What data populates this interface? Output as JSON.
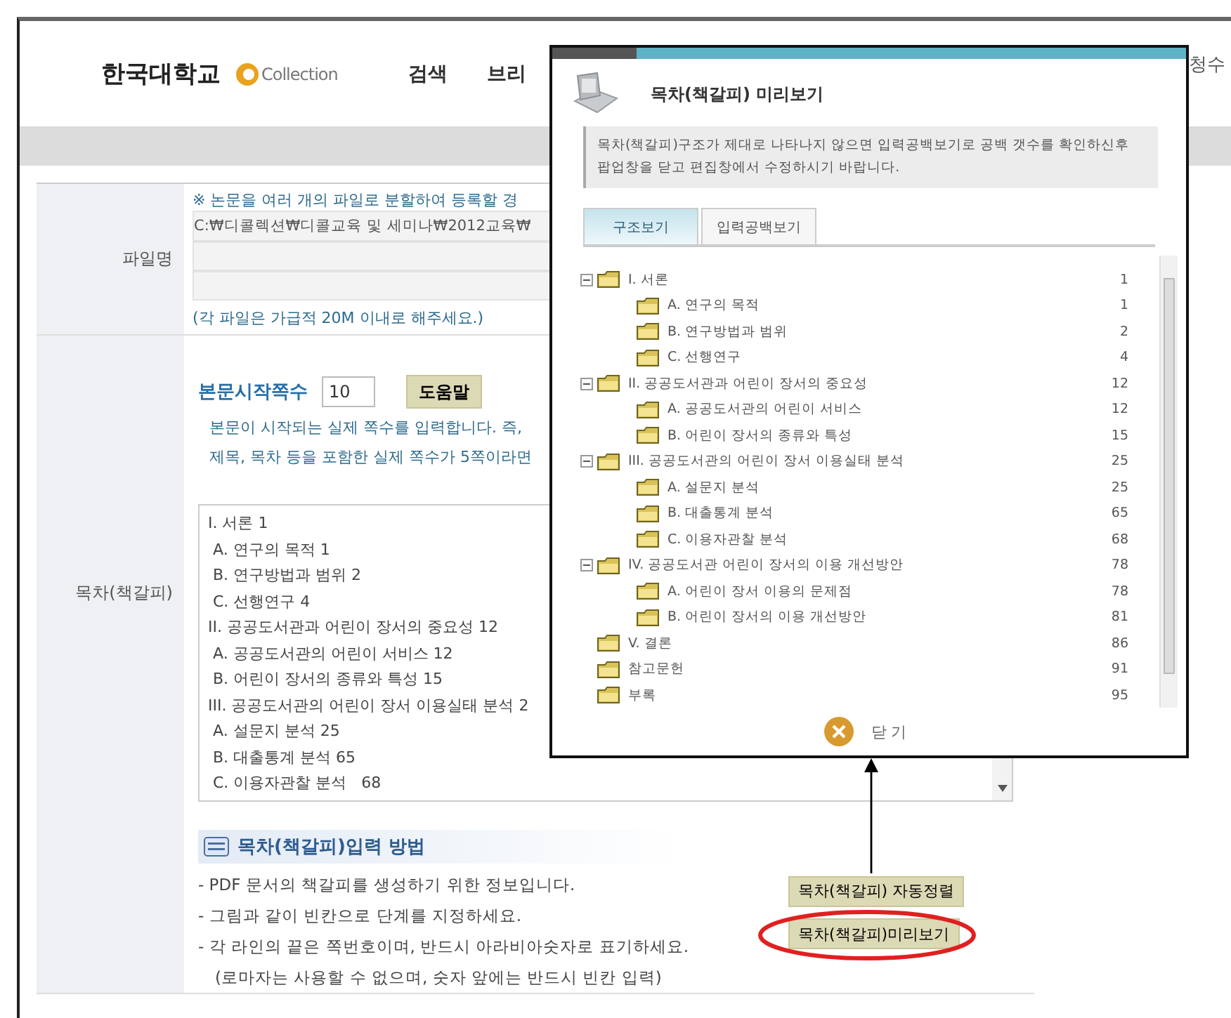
{
  "header": {
    "university": "한국대학교",
    "logo_text": "Collection",
    "nav": [
      "검색",
      "브리"
    ],
    "corner_text": "청수"
  },
  "form": {
    "file_row": {
      "label": "파일명",
      "notice": "※ 논문을 여러 개의 파일로 분할하여 등록할 경",
      "path_value": "C:₩디콜렉션₩디콜교육 및 세미나₩2012교육₩",
      "note": "(각 파일은 가급적 20M 이내로 해주세요.)"
    },
    "toc_row": {
      "label": "목차(책갈피)",
      "start_label": "본문시작쪽수",
      "start_value": "10",
      "help_button": "도움말",
      "help_lines": [
        "본문이 시작되는 실제 쪽수를 입력합니다. 즉,",
        "제목, 목차 등을 포함한 실제 쪽수가 5쪽이라면"
      ],
      "outline_lines": [
        "I. 서론 1",
        " A. 연구의 목적 1",
        " B. 연구방법과 범위 2",
        " C. 선행연구 4",
        "II. 공공도서관과 어린이 장서의 중요성 12",
        " A. 공공도서관의 어린이 서비스 12",
        " B. 어린이 장서의 종류와 특성 15",
        "III. 공공도서관의 어린이 장서 이용실태 분석 2",
        " A. 설문지 분석 25",
        " B. 대출통계 분석 65",
        " C. 이용자관찰 분석   68"
      ],
      "method_title": "목차(책갈피)입력 방법",
      "method_lines": [
        "- PDF 문서의 책갈피를 생성하기 위한 정보입니다.",
        "- 그림과 같이 빈칸으로 단계를 지정하세요.",
        "- 각 라인의 끝은 쪽번호이며, 반드시 아라비아숫자로 표기하세요.",
        "(로마자는 사용할 수 없으며, 숫자 앞에는 반드시 빈칸 입력)"
      ],
      "buttons": [
        {
          "label": "목차(책갈피) 자동정렬",
          "highlighted": false
        },
        {
          "label": "목차(책갈피)미리보기",
          "highlighted": true
        }
      ]
    }
  },
  "popup": {
    "title": "목차(책갈피) 미리보기",
    "notice": "목차(책갈피)구조가 제대로 나타나지 않으면 입력공백보기로 공백 갯수를 확인하신후 팝업창을 닫고 편집창에서 수정하시기 바랍니다.",
    "tabs": [
      {
        "label": "구조보기",
        "selected": true
      },
      {
        "label": "입력공백보기",
        "selected": false
      }
    ],
    "tree": [
      {
        "label": "I. 서론",
        "page": "1",
        "expanded": true,
        "children": [
          {
            "label": "A. 연구의 목적",
            "page": "1"
          },
          {
            "label": "B. 연구방법과 범위",
            "page": "2"
          },
          {
            "label": "C. 선행연구",
            "page": "4"
          }
        ]
      },
      {
        "label": "II. 공공도서관과 어린이 장서의 중요성",
        "page": "12",
        "expanded": true,
        "children": [
          {
            "label": "A. 공공도서관의 어린이 서비스",
            "page": "12"
          },
          {
            "label": "B. 어린이 장서의 종류와 특성",
            "page": "15"
          }
        ]
      },
      {
        "label": "III. 공공도서관의 어린이 장서 이용실태 분석",
        "page": "25",
        "expanded": true,
        "children": [
          {
            "label": "A. 설문지 분석",
            "page": "25"
          },
          {
            "label": "B. 대출통계 분석",
            "page": "65"
          },
          {
            "label": "C. 이용자관찰 분석",
            "page": "68"
          }
        ]
      },
      {
        "label": "IV. 공공도서관 어린이 장서의 이용 개선방안",
        "page": "78",
        "expanded": true,
        "children": [
          {
            "label": "A. 어린이 장서 이용의 문제점",
            "page": "78"
          },
          {
            "label": "B. 어린이 장서의 이용 개선방안",
            "page": "81"
          }
        ]
      },
      {
        "label": "V. 결론",
        "page": "86"
      },
      {
        "label": "참고문헌",
        "page": "91"
      },
      {
        "label": "부록",
        "page": "95"
      }
    ],
    "close_button": "닫 기"
  }
}
